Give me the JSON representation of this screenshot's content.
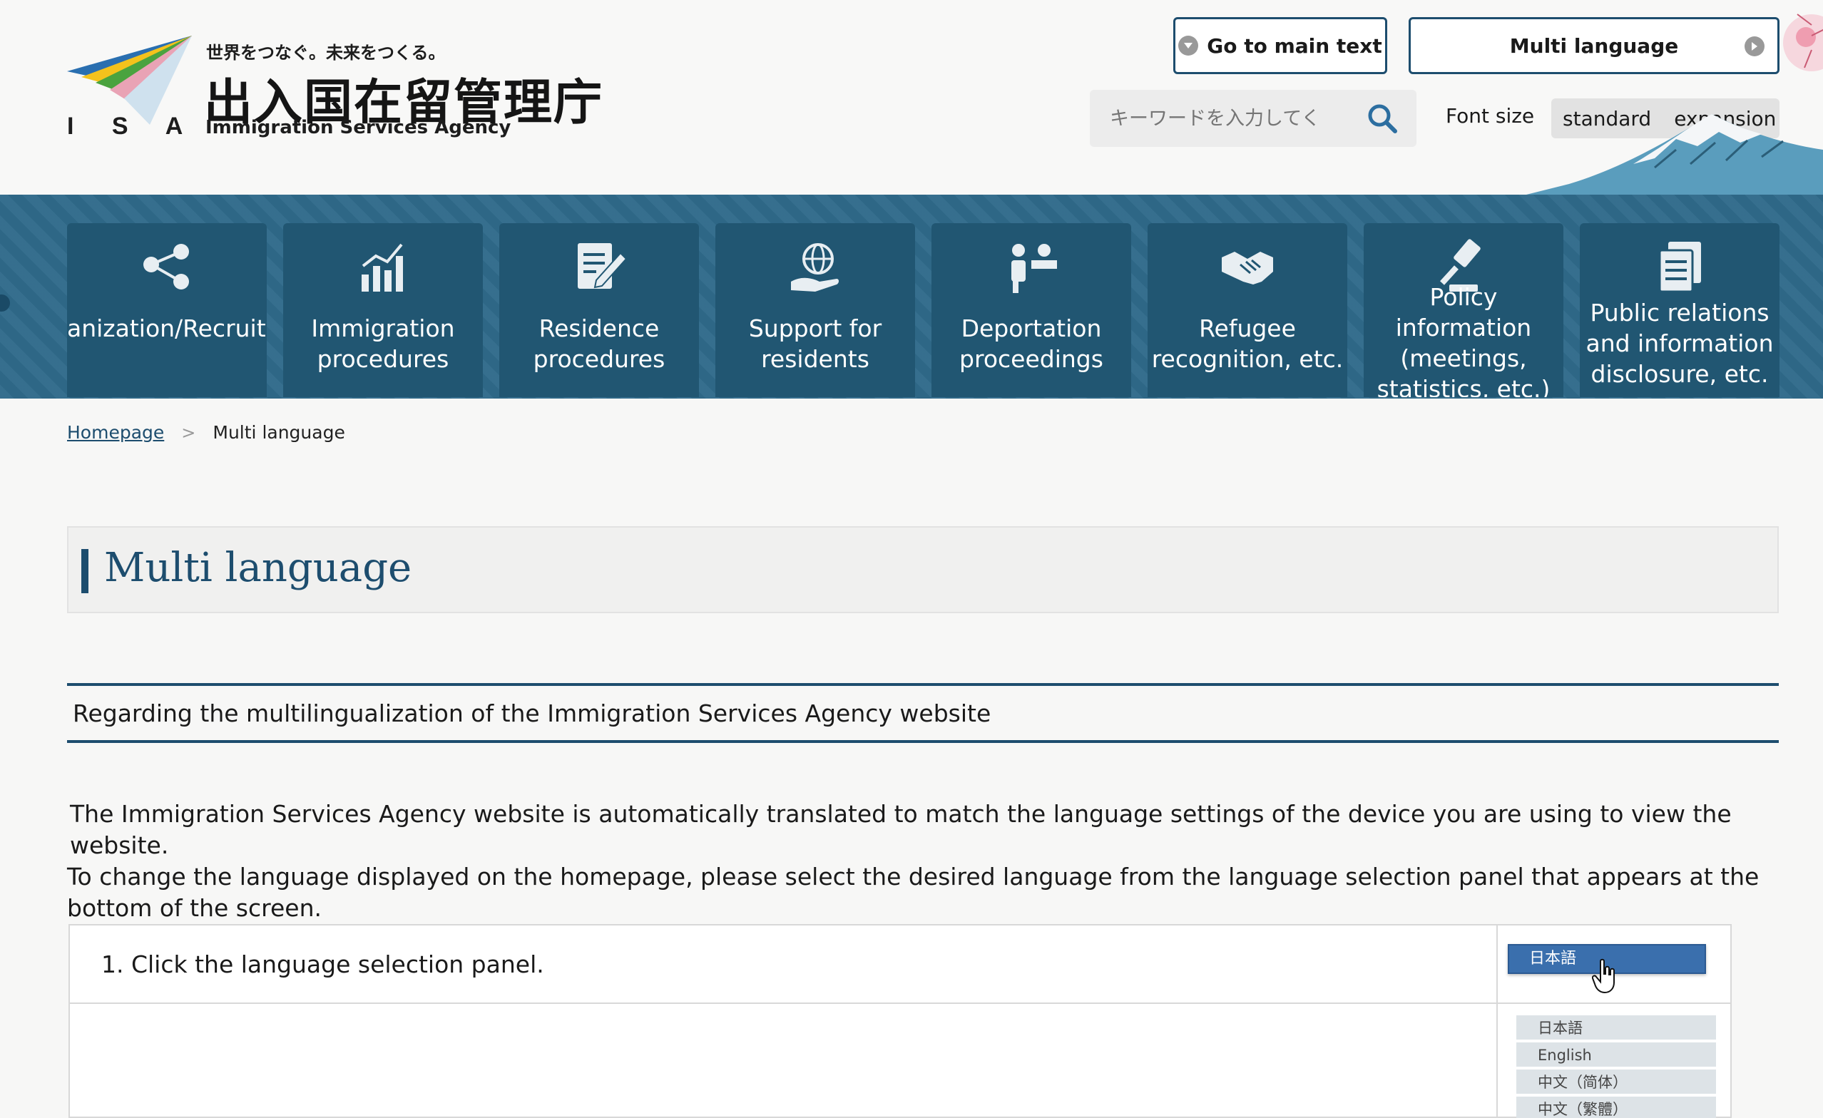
{
  "header": {
    "logo": {
      "isa": "I S A",
      "tagline": "世界をつなぐ。未来をつくる。",
      "name_ja": "出入国在留管理庁",
      "name_en": "Immigration Services Agency"
    },
    "go_main_label": "Go to main text",
    "multi_language_label": "Multi language",
    "search": {
      "placeholder": "キーワードを入力してく"
    },
    "font_size": {
      "label": "Font size",
      "options": [
        "standard",
        "expansion"
      ]
    }
  },
  "nav": {
    "items": [
      {
        "label": "anization/Recruitm",
        "icon": "organization-icon"
      },
      {
        "label": "Immigration procedures",
        "icon": "chart-icon"
      },
      {
        "label": "Residence procedures",
        "icon": "document-edit-icon"
      },
      {
        "label": "Support for residents",
        "icon": "globe-hand-icon"
      },
      {
        "label": "Deportation proceedings",
        "icon": "people-icon"
      },
      {
        "label": "Refugee recognition, etc.",
        "icon": "handshake-icon"
      },
      {
        "label": "Policy information (meetings, statistics, etc.)",
        "icon": "gavel-icon"
      },
      {
        "label": "Public relations and information disclosure, etc.",
        "icon": "documents-icon"
      }
    ]
  },
  "breadcrumb": {
    "home": "Homepage",
    "current": "Multi language"
  },
  "page_title": "Multi language",
  "section_heading": "Regarding the multilingualization of the Immigration Services Agency website",
  "intro": {
    "line1": "The Immigration Services Agency website is automatically translated to match the language settings of the device you are using to view the website.",
    "line2": "To change the language displayed on the homepage, please select the desired language from the language selection panel that appears at the bottom of the screen."
  },
  "steps": {
    "step1": "1. Click the language selection panel.",
    "sample_selected": "日本語",
    "sample_options": [
      "日本語",
      "English",
      "中文（简体）",
      "中文（繁體）"
    ]
  },
  "colors": {
    "brand_blue": "#1d4d6e",
    "nav_bg": "#2f6a8a",
    "nav_tile": "#215672",
    "select_blue": "#3a6fad"
  }
}
